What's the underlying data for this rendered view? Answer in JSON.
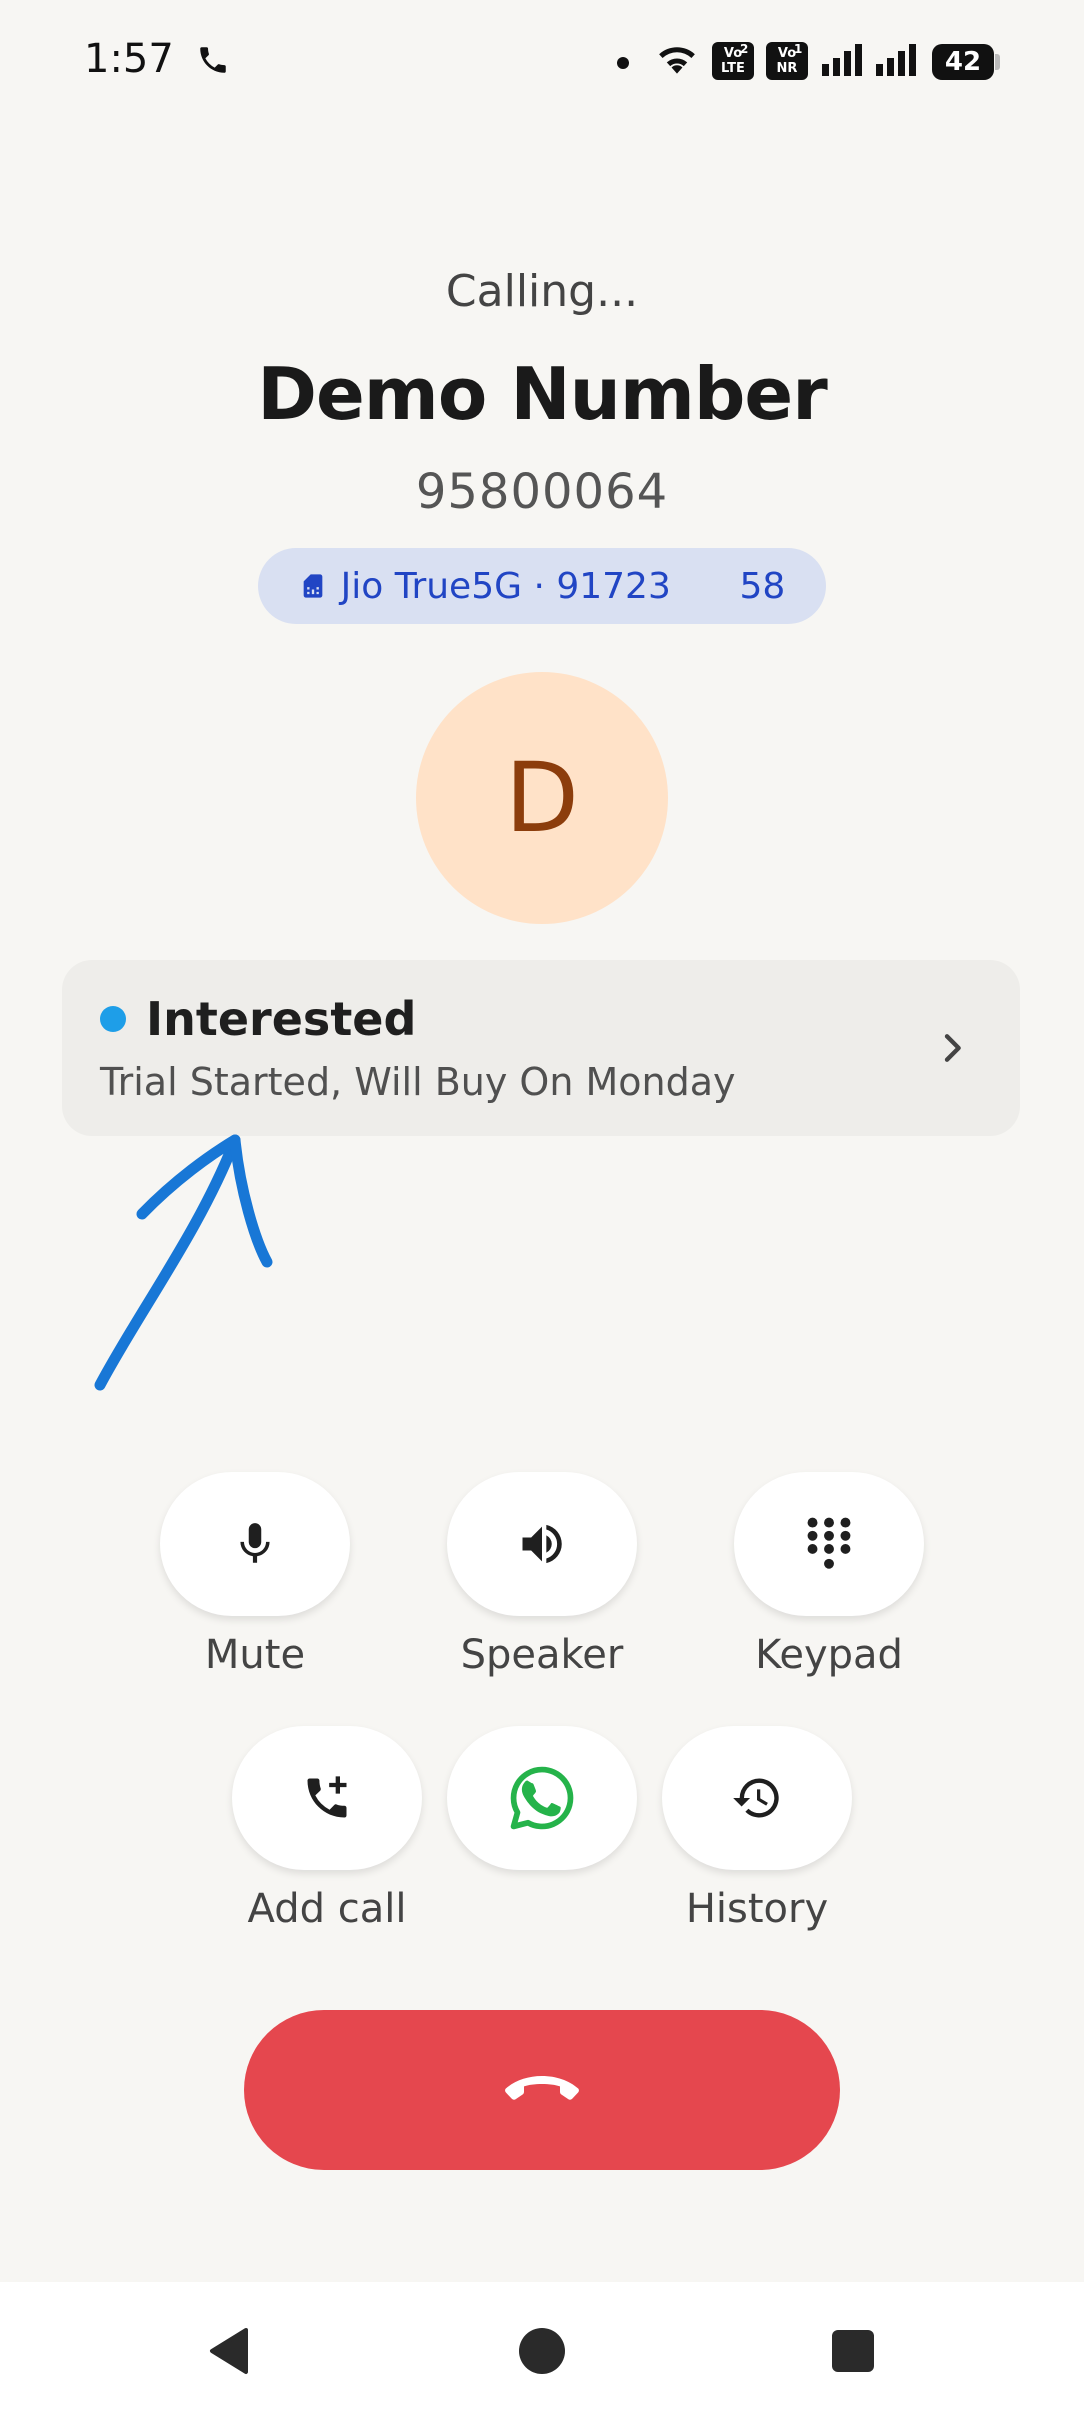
{
  "status_bar": {
    "time": "1:57",
    "lte_badge": [
      "Vo",
      "LTE"
    ],
    "lte_sim": "2",
    "nr_badge": [
      "Vo",
      "NR"
    ],
    "nr_sim": "1",
    "battery": "42"
  },
  "call": {
    "status": "Calling...",
    "contact_name": "Demo Number",
    "phone_number": "95800064",
    "sim_label": "Jio True5G · 91723      58",
    "avatar_initial": "D"
  },
  "lead_status": {
    "title": "Interested",
    "note": "Trial Started, Will Buy On Monday",
    "dot_color": "#1e9ee8"
  },
  "actions": [
    {
      "label": "Mute",
      "icon": "mic-icon"
    },
    {
      "label": "Speaker",
      "icon": "speaker-icon"
    },
    {
      "label": "Keypad",
      "icon": "keypad-icon"
    },
    {
      "label": "Add call",
      "icon": "add-call-icon"
    },
    {
      "label": "",
      "icon": "whatsapp-icon"
    },
    {
      "label": "History",
      "icon": "history-icon"
    }
  ],
  "colors": {
    "end_call": "#e5474e",
    "whatsapp": "#25b34a",
    "sim_pill": "#d9e0f2",
    "annotation_arrow": "#1877d6"
  }
}
